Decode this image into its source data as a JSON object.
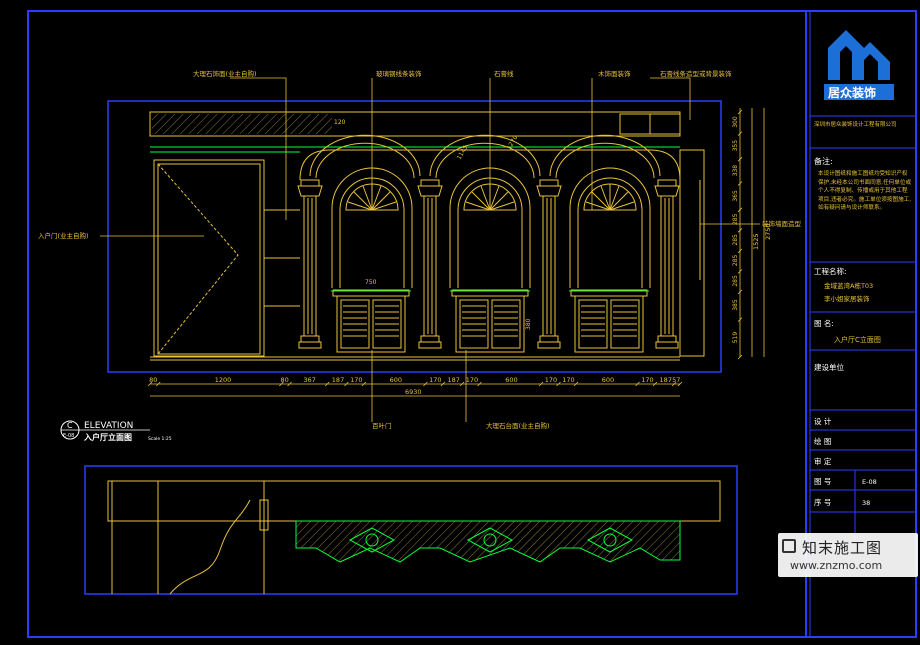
{
  "sheet": {
    "border_color": "#2b3dff",
    "line_color": "#e8c23a",
    "accent_green": "#00ff3c",
    "accent_cyan": "#19d3d3"
  },
  "drawing": {
    "leaders_top": [
      "大理石饰面(业主自购)",
      "玻璃钢线条装饰",
      "石膏线",
      "木饰面装饰",
      "石膏线条造型或背景装饰"
    ],
    "leader_left": "入户门(业主自购)",
    "leader_right": "装饰墙面造型",
    "leaders_bottom": [
      "百叶门",
      "大理石台面(业主自购)"
    ],
    "dims_bottom": [
      "80",
      "1200",
      "80",
      "367",
      "187",
      "170",
      "600",
      "170",
      "187",
      "170",
      "600",
      "170",
      "170",
      "600",
      "170",
      "187",
      "57"
    ],
    "dim_total": "6930",
    "dims_right": [
      "300",
      "355",
      "338",
      "365",
      "285",
      "285",
      "285",
      "285",
      "385",
      "519"
    ],
    "dims_right_group": [
      "2750",
      "1525"
    ],
    "small_labels": [
      "120",
      "750",
      "380",
      "1145",
      "1270",
      "1270"
    ]
  },
  "elevation_tag": {
    "letter": "C",
    "sheet": "E-08",
    "word": "ELEVATION",
    "title": "入户厅立面图",
    "scale": "Scale 1:25"
  },
  "title_block": {
    "logo_text": "居众装饰",
    "company": "深圳市居众装饰设计工程有限公司",
    "notes_label": "备注:",
    "notes_body": "本设计图纸和施工图纸均受知识产权保护,未经本公司书面同意,任何单位或个人不得复制、传播或用于其他工程项目,违者必究。施工单位须按图施工,如有疑问请与设计师联系。",
    "project_label": "工程名称:",
    "project_name_1": "金域蓝湾A栋T03",
    "project_name_2": "李小姐家居装饰",
    "drawing_label": "图  名:",
    "drawing_name": "入户厅C立面图",
    "unit_label": "建设单位",
    "design_label": "设  计",
    "draw_label": "绘  图",
    "review_label": "审  定",
    "sheet_no_label": "图  号",
    "sheet_no": "E-08",
    "seq_label": "序  号",
    "seq": "38"
  },
  "watermark": {
    "brand": "知末施工图",
    "url": "www.znzmo.com"
  }
}
